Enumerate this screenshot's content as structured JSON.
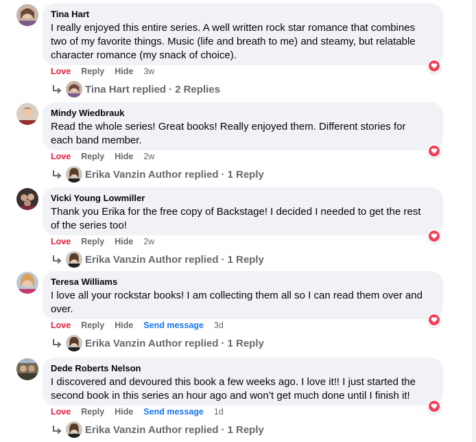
{
  "comments": [
    {
      "author": "Tina Hart",
      "text_lines": [
        "I really enjoyed this entire series. A well written rock star romance that combines",
        "two of my favorite things. Music (life and breath to me) and steamy, but relatable",
        "character romance (my snack of choice)."
      ],
      "actions": {
        "love": "Love",
        "reply": "Reply",
        "hide": "Hide",
        "send": "",
        "time": "3w"
      },
      "replies": {
        "replier": "Tina Hart replied",
        "sep": "·",
        "count": "2 Replies"
      }
    },
    {
      "author": "Mindy Wiedbrauk",
      "text_lines": [
        "Read the whole series! Great books! Really enjoyed them. Different stories for",
        "each band member."
      ],
      "actions": {
        "love": "Love",
        "reply": "Reply",
        "hide": "Hide",
        "send": "",
        "time": "2w"
      },
      "replies": {
        "replier": "Erika Vanzin Author replied",
        "sep": "·",
        "count": "1 Reply"
      }
    },
    {
      "author": "Vicki Young Lowmiller",
      "text_lines": [
        "Thank you Erika for the free copy of Backstage! I decided I needed to get the rest",
        "of the series too!"
      ],
      "actions": {
        "love": "Love",
        "reply": "Reply",
        "hide": "Hide",
        "send": "",
        "time": "2w"
      },
      "replies": {
        "replier": "Erika Vanzin Author replied",
        "sep": "·",
        "count": "1 Reply"
      }
    },
    {
      "author": "Teresa Williams",
      "text_lines": [
        "I love all your rockstar books! I am collecting them all so I can read them over and",
        "over."
      ],
      "actions": {
        "love": "Love",
        "reply": "Reply",
        "hide": "Hide",
        "send": "Send message",
        "time": "3d"
      },
      "replies": {
        "replier": "Erika Vanzin Author replied",
        "sep": "·",
        "count": "1 Reply"
      }
    },
    {
      "author": "Dede Roberts Nelson",
      "text_lines": [
        "I discovered and devoured this book a few weeks ago. I love it!! I just started the",
        "second book in this series an hour ago and won’t get much done until I finish it!"
      ],
      "actions": {
        "love": "Love",
        "reply": "Reply",
        "hide": "Hide",
        "send": "Send message",
        "time": "1d"
      },
      "replies": {
        "replier": "Erika Vanzin Author replied",
        "sep": "·",
        "count": "1 Reply"
      }
    }
  ],
  "icons": {
    "reaction": "heart-reaction-icon",
    "reply_arrow": "reply-arrow-icon"
  },
  "colors": {
    "love": "#e41e3f",
    "send": "#1877f2",
    "muted": "#65676b",
    "bubble": "#f0f2f5",
    "heart": "#f33e58"
  }
}
